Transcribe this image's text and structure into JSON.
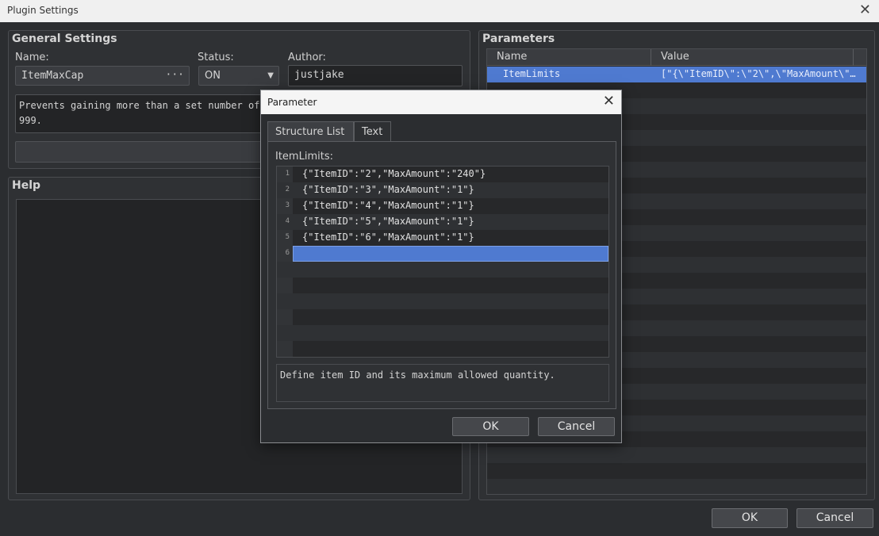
{
  "window": {
    "title": "Plugin Settings",
    "close_glyph": "✕"
  },
  "general": {
    "title": "General Settings",
    "name_label": "Name:",
    "name_value": "ItemMaxCap",
    "name_more": "···",
    "status_label": "Status:",
    "status_value": "ON",
    "status_caret": "▼",
    "author_label": "Author:",
    "author_value": "justjake",
    "description_line1": "Prevents gaining more than a set number of s",
    "description_line2": "999."
  },
  "help": {
    "title": "Help"
  },
  "parameters": {
    "title": "Parameters",
    "col_name": "Name",
    "col_value": "Value",
    "rows": [
      {
        "name": "ItemLimits",
        "value": "[\"{\\\"ItemID\\\":\\\"2\\\",\\\"MaxAmount\\\"…"
      }
    ]
  },
  "footer": {
    "ok": "OK",
    "cancel": "Cancel"
  },
  "dialog": {
    "title": "Parameter",
    "close_glyph": "✕",
    "tabs": [
      "Structure List",
      "Text"
    ],
    "field_label": "ItemLimits:",
    "lines": [
      {
        "num": "1",
        "code": "{\"ItemID\":\"2\",\"MaxAmount\":\"240\"}"
      },
      {
        "num": "2",
        "code": "{\"ItemID\":\"3\",\"MaxAmount\":\"1\"}"
      },
      {
        "num": "3",
        "code": "{\"ItemID\":\"4\",\"MaxAmount\":\"1\"}"
      },
      {
        "num": "4",
        "code": "{\"ItemID\":\"5\",\"MaxAmount\":\"1\"}"
      },
      {
        "num": "5",
        "code": "{\"ItemID\":\"6\",\"MaxAmount\":\"1\"}"
      },
      {
        "num": "6",
        "code": ""
      }
    ],
    "description": "Define item ID and its maximum allowed quantity.",
    "ok": "OK",
    "cancel": "Cancel"
  },
  "colors": {
    "selection": "#4f7ad0",
    "background": "#2b2d30"
  }
}
